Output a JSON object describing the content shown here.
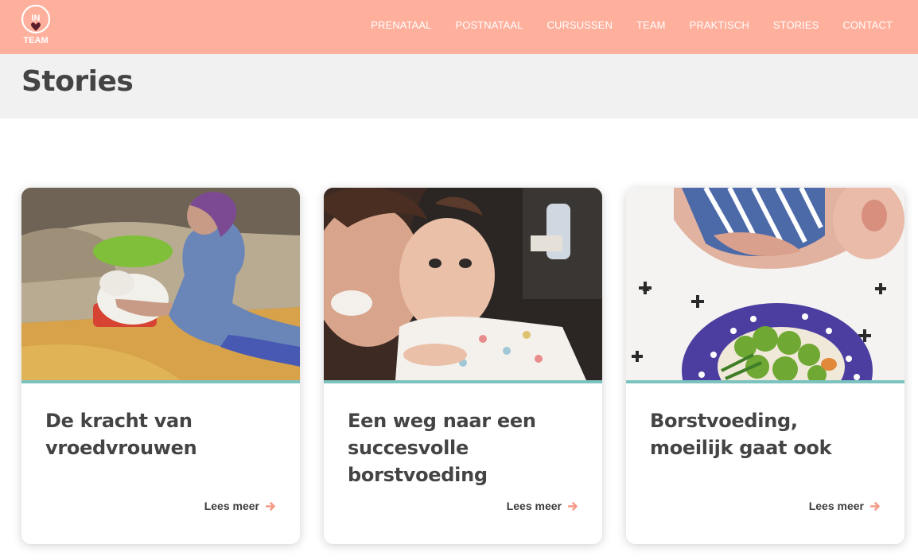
{
  "header": {
    "logo": {
      "top_text": "IN",
      "bottom_text": "TEAM",
      "icon": "heart-icon"
    },
    "nav": [
      {
        "label": "PRENATAAL"
      },
      {
        "label": "POSTNATAAL"
      },
      {
        "label": "CURSUSSEN"
      },
      {
        "label": "TEAM"
      },
      {
        "label": "PRAKTISCH"
      },
      {
        "label": "STORIES"
      },
      {
        "label": "CONTACT"
      }
    ]
  },
  "page": {
    "title": "Stories"
  },
  "cards": [
    {
      "title": "De kracht van vroedvrouwen",
      "link_label": "Lees meer",
      "image": "midwife-with-newborn-photo"
    },
    {
      "title": "Een weg naar een succesvolle borstvoeding",
      "link_label": "Lees meer",
      "image": "mother-and-baby-selfie-photo"
    },
    {
      "title": "Borstvoeding, moeilijk gaat ook",
      "link_label": "Lees meer",
      "image": "breastfeeding-with-vegetable-plate-photo"
    }
  ],
  "colors": {
    "header_bg": "#ffb09c",
    "title_band_bg": "#f1f1f1",
    "card_divider": "#7cc3bf",
    "arrow": "#f49a86",
    "text": "#444444"
  }
}
